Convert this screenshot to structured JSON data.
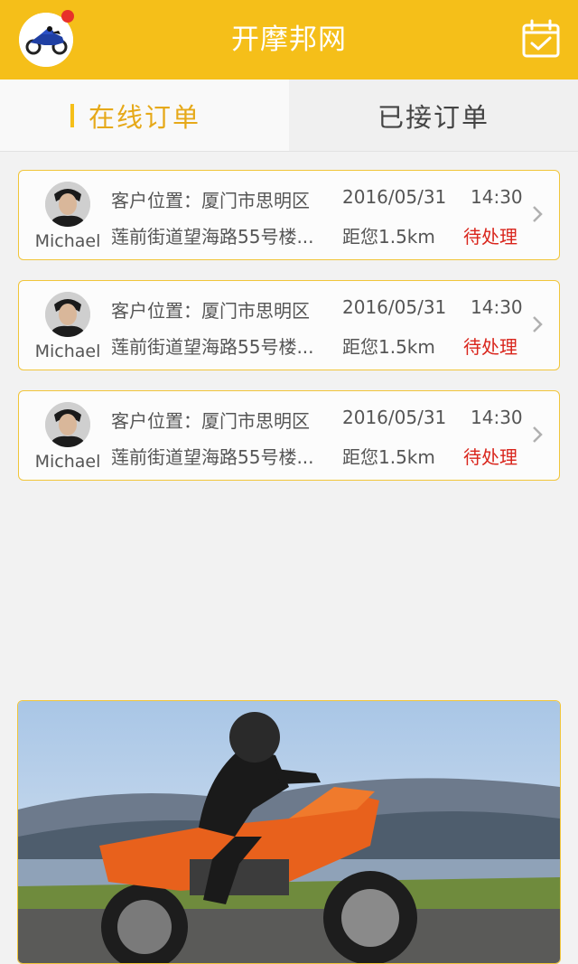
{
  "header": {
    "title": "开摩邦网",
    "colors": {
      "bar": "#f5bf19",
      "notification": "#e8312a"
    },
    "icons": {
      "left": "motorcycle-avatar-icon",
      "right": "calendar-check-icon"
    }
  },
  "tabs": [
    {
      "label": "在线订单",
      "active": true
    },
    {
      "label": "已接订单",
      "active": false
    }
  ],
  "orders": [
    {
      "customer_name": "Michael",
      "location_label": "客户位置：",
      "location_value": "厦门市思明区",
      "date": "2016/05/31",
      "time": "14:30",
      "address": "莲前街道望海路55号楼...",
      "distance": "距您1.5km",
      "status": "待处理"
    },
    {
      "customer_name": "Michael",
      "location_label": "客户位置：",
      "location_value": "厦门市思明区",
      "date": "2016/05/31",
      "time": "14:30",
      "address": "莲前街道望海路55号楼...",
      "distance": "距您1.5km",
      "status": "待处理"
    },
    {
      "customer_name": "Michael",
      "location_label": "客户位置：",
      "location_value": "厦门市思明区",
      "date": "2016/05/31",
      "time": "14:30",
      "address": "莲前街道望海路55号楼...",
      "distance": "距您1.5km",
      "status": "待处理"
    }
  ],
  "status_color": "#d9251c",
  "banner": {
    "subject": "motorcycle-rider-photo"
  }
}
